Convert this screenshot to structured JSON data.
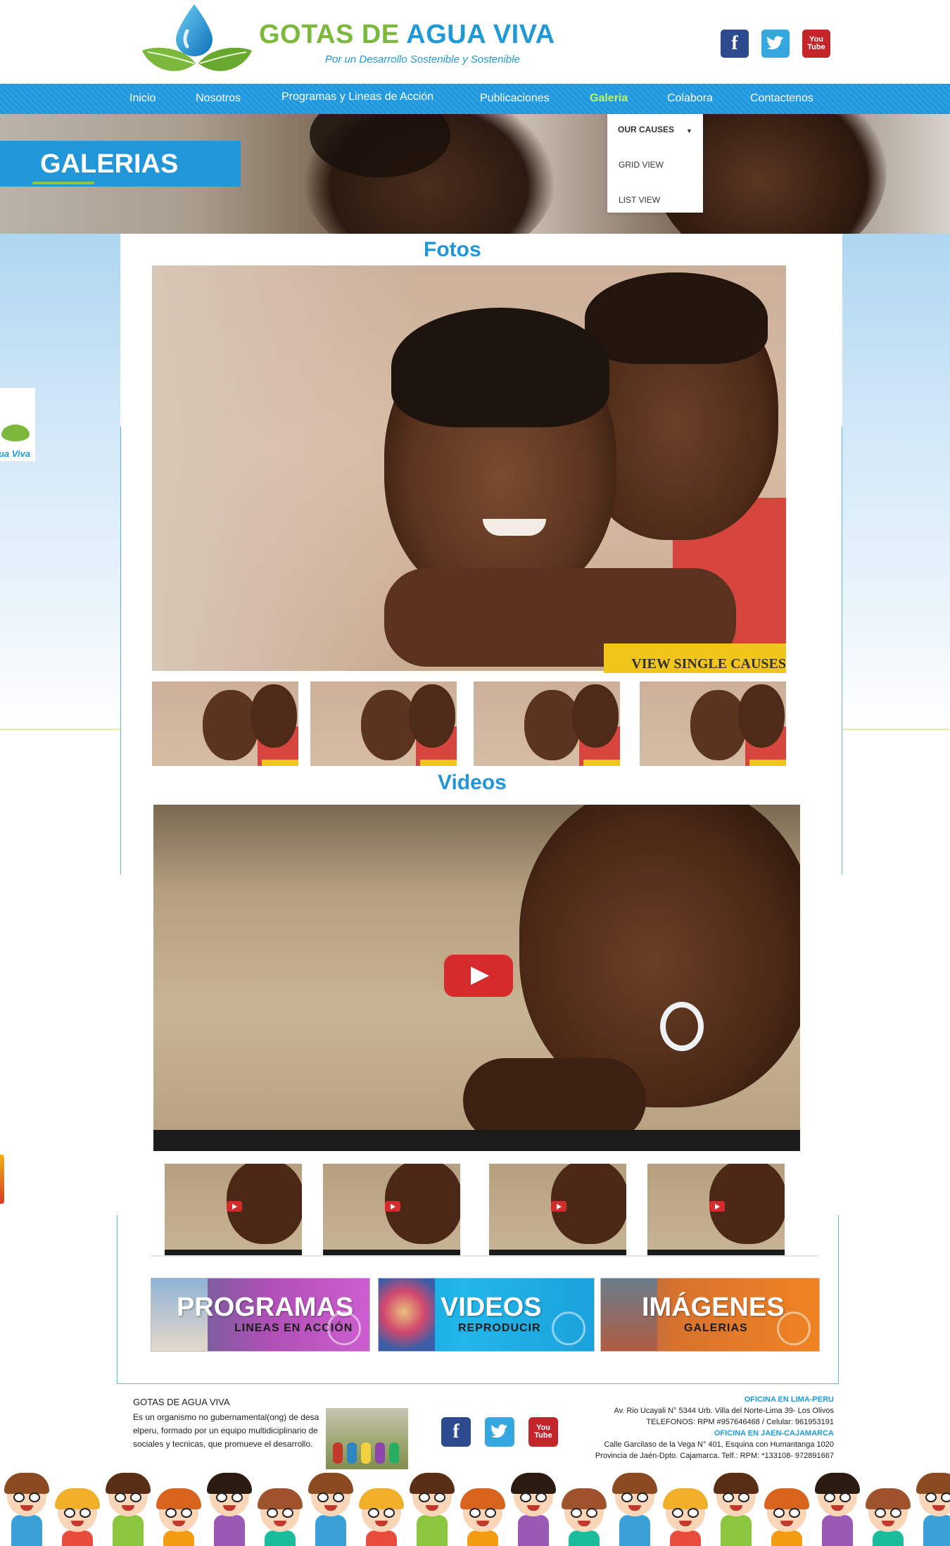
{
  "brand": {
    "title_part1": "GOTAS DE",
    "title_part2": "AGUA VIVA",
    "tagline": "Por un Desarrollo Sostenible y Sostenible",
    "colors": {
      "green": "#7cb83b",
      "blue": "#1f9ad6"
    }
  },
  "social": {
    "facebook_icon": "f",
    "twitter_icon": "bird-icon",
    "youtube_top": "You",
    "youtube_bottom": "Tube"
  },
  "nav": {
    "items": [
      {
        "label": "Inicio"
      },
      {
        "label": "Nosotros"
      },
      {
        "label": "Programas y Lineas de Acción"
      },
      {
        "label": "Publicaciones"
      },
      {
        "label": "Galeria"
      },
      {
        "label": "Colabora"
      },
      {
        "label": "Contactenos"
      }
    ],
    "active": "Galeria",
    "active_color": "#bff36a"
  },
  "dropdown": {
    "title": "OUR CAUSES",
    "items": [
      "GRID VIEW",
      "LIST VIEW"
    ]
  },
  "hero": {
    "label": "GALERIAS"
  },
  "side_badge": {
    "text": "ua Viva"
  },
  "gallery": {
    "photos_title": "Fotos",
    "view_button": "VIEW SINGLE CAUSES",
    "thumbnails": 4,
    "videos_title": "Videos",
    "video_thumbnails": 4
  },
  "banners": [
    {
      "title": "PROGRAMAS",
      "subtitle": "LINEAS EN ACCIÓN",
      "color": "#b14fb7"
    },
    {
      "title": "VIDEOS",
      "subtitle": "REPRODUCIR",
      "color": "#17a4dc"
    },
    {
      "title": "IMÁGENES",
      "subtitle": "GALERIAS",
      "color": "#f08322"
    }
  ],
  "footer": {
    "title": "GOTAS DE AGUA VIVA",
    "text_lines": [
      "Es un organismo no gubernamental(ong) de desa",
      "elperu, formado por un equipo multidiciplinario de",
      "sociales y tecnicas, que promueve el desarrollo."
    ],
    "offices": [
      {
        "heading": "OFICINA EN LIMA-PERU",
        "lines": [
          "Av. Rio Ucayali N° 5344 Urb. Villa del Norte-Lima 39- Los Olivos",
          "TELEFONOS: RPM #957646468 / Celular: 961953191"
        ]
      },
      {
        "heading": "OFICINA EN JAEN-CAJAMARCA",
        "lines": [
          "Calle Garcilaso de la Vega N° 401, Esquina con Humantanga 1020",
          "Provincia de Jaén-Dpto. Cajamarca. Telf.: RPM: *133108- 972891667"
        ]
      }
    ]
  }
}
